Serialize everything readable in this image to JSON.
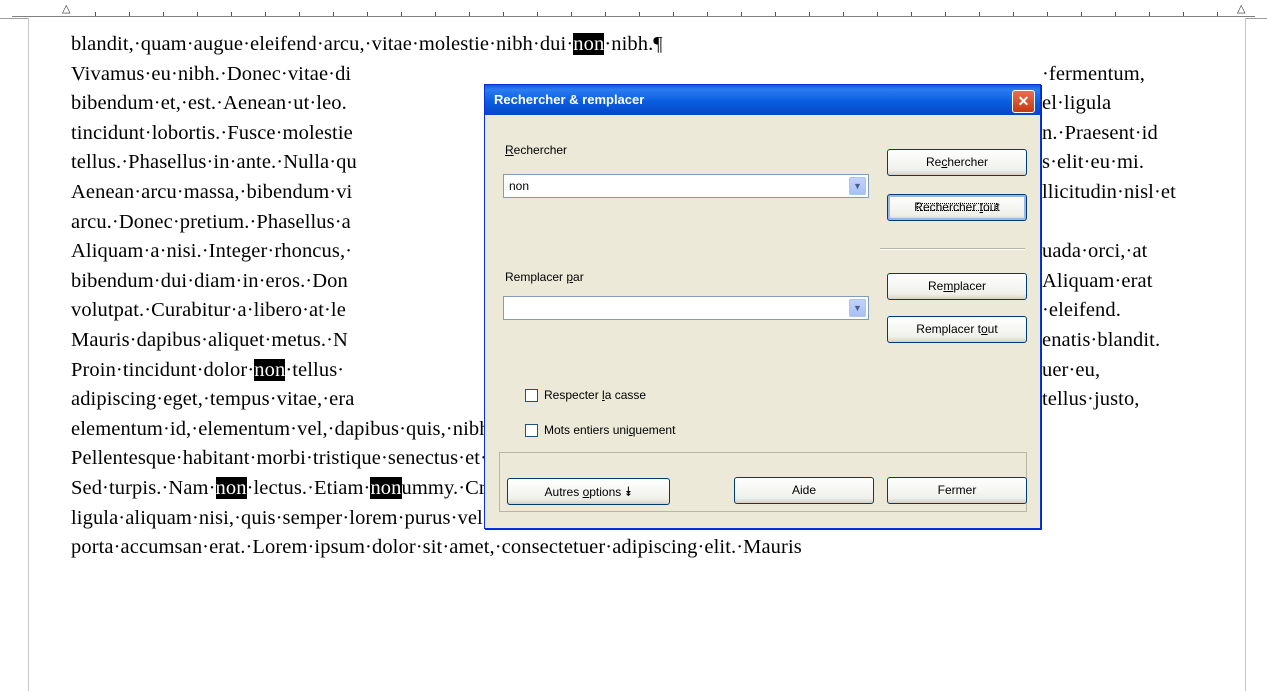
{
  "document": {
    "lines": [
      [
        {
          "t": "blandit,·quam·augue·eleifend·arcu,·vitae·molestie·nibh·dui·"
        },
        {
          "t": "non",
          "hl": true
        },
        {
          "t": "·nibh.¶"
        }
      ],
      [
        {
          "t": "Vivamus·eu·nibh.·Donec·vitae·di"
        },
        {
          "t": "                                                 ",
          "gap": true
        },
        {
          "t": "·fermentum,"
        }
      ],
      [
        {
          "t": "bibendum·et,·est.·Aenean·ut·leo."
        },
        {
          "t": "                                                 ",
          "gap": true
        },
        {
          "t": "el·ligula"
        }
      ],
      [
        {
          "t": "tincidunt·lobortis.·Fusce·molestie"
        },
        {
          "t": "                                                 ",
          "gap": true
        },
        {
          "t": "n.·Praesent·id"
        }
      ],
      [
        {
          "t": "tellus.·Phasellus·in·ante.·Nulla·qu"
        },
        {
          "t": "                                                 ",
          "gap": true
        },
        {
          "t": "s·elit·eu·mi."
        }
      ],
      [
        {
          "t": "Aenean·arcu·massa,·bibendum·vi"
        },
        {
          "t": "                                                 ",
          "gap": true
        },
        {
          "t": "llicitudin·nisl·et"
        }
      ],
      [
        {
          "t": "arcu.·Donec·pretium.·Phasellus·a"
        }
      ],
      [
        {
          "t": "Aliquam·a·nisi.·Integer·rhoncus,·"
        },
        {
          "t": "                                                 ",
          "gap": true
        },
        {
          "t": "uada·orci,·at"
        }
      ],
      [
        {
          "t": "bibendum·dui·diam·in·eros.·Don"
        },
        {
          "t": "                                                 ",
          "gap": true
        },
        {
          "t": "Aliquam·erat"
        }
      ],
      [
        {
          "t": "volutpat.·Curabitur·a·libero·at·le"
        },
        {
          "t": "                                                 ",
          "gap": true
        },
        {
          "t": "·eleifend."
        }
      ],
      [
        {
          "t": "Mauris·dapibus·aliquet·metus.·N"
        },
        {
          "t": "                                                 ",
          "gap": true
        },
        {
          "t": "enatis·blandit."
        }
      ],
      [
        {
          "t": "Proin·tincidunt·dolor·"
        },
        {
          "t": "non",
          "hl": true
        },
        {
          "t": "·tellus·"
        },
        {
          "t": "                                                 ",
          "gap": true
        },
        {
          "t": "uer·eu,"
        }
      ],
      [
        {
          "t": "adipiscing·eget,·tempus·vitae,·era"
        },
        {
          "t": "                                                 ",
          "gap": true
        },
        {
          "t": "tellus·justo,"
        }
      ],
      [
        {
          "t": "elementum·id,·elementum·vel,·dapibus·quis,·nibh.·Aliquam·rhoncus·ante·in·lectus."
        }
      ],
      [
        {
          "t": "Pellentesque·habitant·morbi·tristique·senectus·et·netus·et·malesuada·fames·ac·turpis·egestas.¶"
        }
      ],
      [
        {
          "t": "Sed·turpis.·Nam·"
        },
        {
          "t": "non",
          "hl": true
        },
        {
          "t": "·lectus.·Etiam·"
        },
        {
          "t": "non",
          "hl": true
        },
        {
          "t": "ummy.·Cras·egestas,·pede·eget·porta·luctus,·lacus"
        }
      ],
      [
        {
          "t": "ligula·aliquam·nisi,·quis·semper·lorem·purus·vel·metus.·Ut·pellentesque·sagittis·velit.·Quisque"
        }
      ],
      [
        {
          "t": "porta·accumsan·erat.·Lorem·ipsum·dolor·sit·amet,·consectetuer·adipiscing·elit.·Mauris"
        }
      ]
    ]
  },
  "dialog": {
    "title": "Rechercher & remplacer",
    "search_label_pre": "",
    "search_label_u": "R",
    "search_label_post": "echercher",
    "search_value": "non",
    "replace_label_pre": "Remplacer ",
    "replace_label_u": "p",
    "replace_label_post": "ar",
    "replace_value": "",
    "btn_search_pre": "Re",
    "btn_search_u": "c",
    "btn_search_post": "hercher",
    "btn_search_all_pre": "Rechercher ",
    "btn_search_all_u": "t",
    "btn_search_all_post": "out",
    "btn_replace_pre": "Re",
    "btn_replace_u": "m",
    "btn_replace_post": "placer",
    "btn_replace_all_pre": "Remplacer t",
    "btn_replace_all_u": "o",
    "btn_replace_all_post": "ut",
    "chk_case_pre": "Respecter ",
    "chk_case_u": "l",
    "chk_case_post": "a casse",
    "chk_case_checked": false,
    "chk_words_pre": "Mots entiers uni",
    "chk_words_u": "q",
    "chk_words_post": "uement",
    "chk_words_checked": false,
    "btn_more_pre": "Autres ",
    "btn_more_u": "o",
    "btn_more_post": "ptions",
    "btn_more_icon": "double-chevron-down",
    "btn_help": "Aide",
    "btn_close": "Fermer",
    "close_icon_glyph": "✕"
  }
}
